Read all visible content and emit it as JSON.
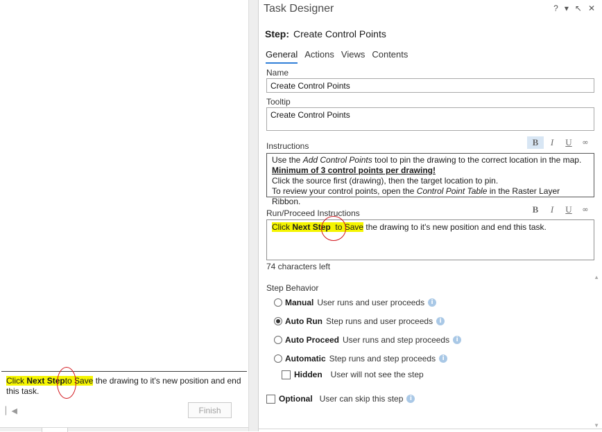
{
  "left_pane": {
    "message": {
      "prefix": "Click ",
      "bold": "Next Step",
      "middle": "to Save",
      "suffix": " the drawing to it's new position and end this task."
    },
    "nav_icon": "first-page-icon",
    "finish_label": "Finish"
  },
  "right_pane": {
    "title": "Task Designer",
    "controls": {
      "help": "?",
      "menu": "▾",
      "pin": "↖",
      "close": "✕"
    },
    "step_label": "Step:",
    "step_name": "Create Control Points",
    "tabs": [
      {
        "label": "General",
        "active": true
      },
      {
        "label": "Actions",
        "active": false
      },
      {
        "label": "Views",
        "active": false
      },
      {
        "label": "Contents",
        "active": false
      }
    ],
    "name": {
      "label": "Name",
      "value": "Create Control Points"
    },
    "tooltip": {
      "label": "Tooltip",
      "value": "Create Control Points"
    },
    "instructions": {
      "label": "Instructions",
      "line1_a": "Use the ",
      "line1_italic": "Add Control Points",
      "line1_b": " tool to pin the drawing to the correct location in the map.",
      "line2": "Minimum of 3 control points per drawing!",
      "line3": "Click the source first (drawing), then the target location to pin.",
      "line4_a": "To review your control points, open the ",
      "line4_italic": "Control Point Table",
      "line4_b": " in the Raster Layer Ribbon."
    },
    "format_toolbar": {
      "bold": "B",
      "italic": "I",
      "underline": "U",
      "link": "∞"
    },
    "run_proceed": {
      "label": "Run/Proceed Instructions",
      "prefix": "Click ",
      "bold": "Next Step",
      "middle": "  to Save",
      "suffix": " the drawing to it's new position and end this task."
    },
    "chars_left": "74 characters left",
    "step_behavior": {
      "label": "Step Behavior",
      "options": [
        {
          "title": "Manual",
          "desc": "User runs and user proceeds",
          "checked": false
        },
        {
          "title": "Auto Run",
          "desc": "Step runs and user proceeds",
          "checked": true
        },
        {
          "title": "Auto Proceed",
          "desc": "User runs and step proceeds",
          "checked": false
        },
        {
          "title": "Automatic",
          "desc": "Step runs and step proceeds",
          "checked": false
        }
      ],
      "hidden": {
        "title": "Hidden",
        "desc": "User will not see the step",
        "checked": false
      },
      "optional": {
        "title": "Optional",
        "desc": "User can skip this step",
        "checked": false
      }
    },
    "info_glyph": "i",
    "colors": {
      "highlight": "#f5f500",
      "accent": "#2f7fd8",
      "annotation": "#d2151c"
    }
  }
}
